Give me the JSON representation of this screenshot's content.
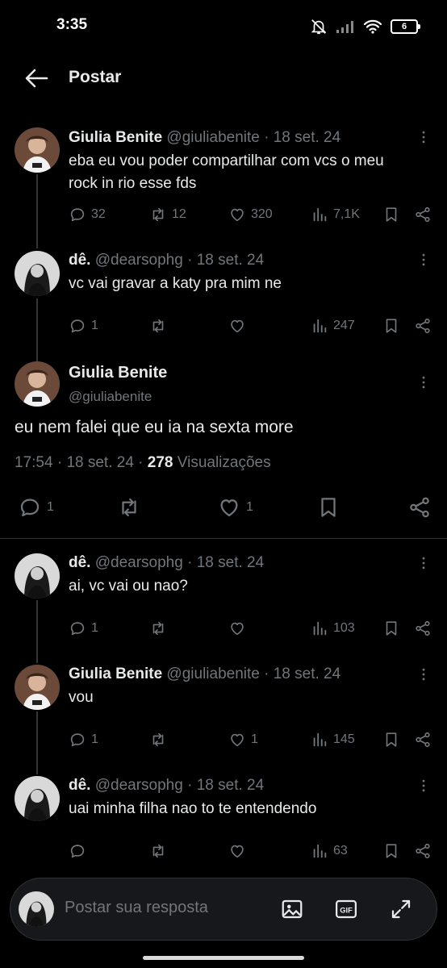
{
  "status_bar": {
    "time": "3:35",
    "battery": "6"
  },
  "header": {
    "title": "Postar"
  },
  "tweets_before": [
    {
      "name": "Giulia Benite",
      "handle": "@giuliabenite",
      "date": "18 set. 24",
      "text": [
        "eba eu vou poder compartilhar com vcs o meu",
        "rock in rio esse fds"
      ],
      "replies": "32",
      "retweets": "12",
      "likes": "320",
      "views": "7,1K"
    },
    {
      "name": "dê.",
      "handle": "@dearsophg",
      "date": "18 set. 24",
      "text": [
        "vc vai gravar a katy pra mim ne"
      ],
      "replies": "1",
      "retweets": "",
      "likes": "",
      "views": "247"
    }
  ],
  "focus_tweet": {
    "name": "Giulia Benite",
    "handle": "@giuliabenite",
    "text": "eu nem falei que eu ia na sexta more",
    "time": "17:54",
    "date": "18 set. 24",
    "views_count": "278",
    "views_label": "Visualizações",
    "replies": "1",
    "likes": "1"
  },
  "replies": [
    {
      "name": "dê.",
      "handle": "@dearsophg",
      "date": "18 set. 24",
      "text": "ai, vc vai ou nao?",
      "replies": "1",
      "retweets": "",
      "likes": "",
      "views": "103"
    },
    {
      "name": "Giulia Benite",
      "handle": "@giuliabenite",
      "date": "18 set. 24",
      "text": "vou",
      "replies": "1",
      "retweets": "",
      "likes": "1",
      "views": "145"
    },
    {
      "name": "dê.",
      "handle": "@dearsophg",
      "date": "18 set. 24",
      "text": "uai minha filha nao to te entendendo",
      "replies": "",
      "retweets": "",
      "likes": "",
      "views": "63"
    }
  ],
  "reply_bar": {
    "placeholder": "Postar sua resposta"
  },
  "colors": {
    "background": "#000000",
    "text": "#e7e9ea",
    "muted": "#71767b",
    "divider": "#2f3336"
  }
}
